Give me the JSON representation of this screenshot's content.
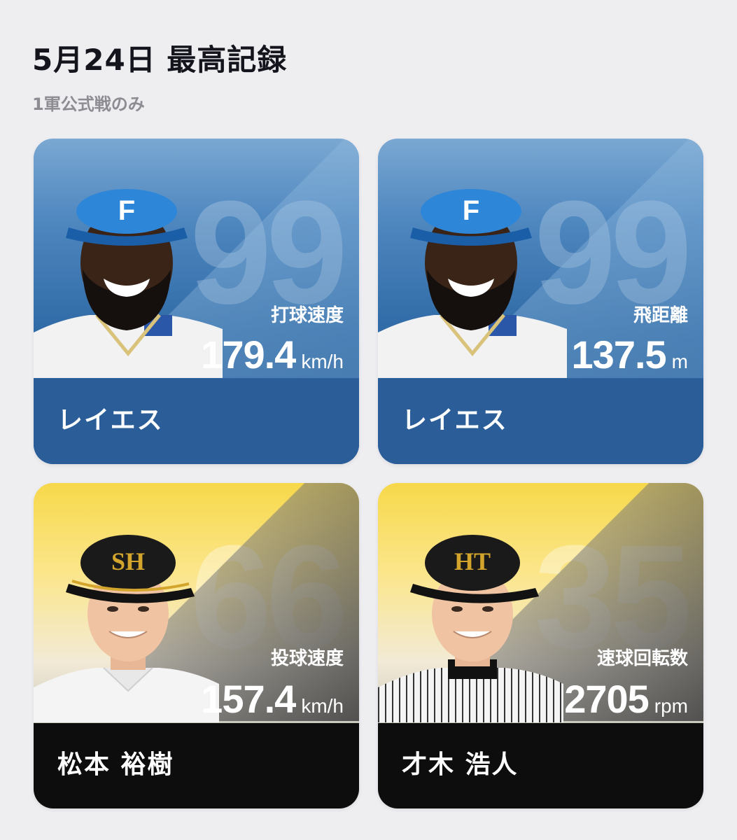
{
  "header": {
    "title": "5月24日 最高記録",
    "subtitle": "1軍公式戦のみ"
  },
  "cards": [
    {
      "theme": "blue",
      "jersey_number": "99",
      "stat_label": "打球速度",
      "stat_value": "179.4",
      "stat_unit": "km/h",
      "player_name": "レイエス",
      "cap_logo": "F"
    },
    {
      "theme": "blue",
      "jersey_number": "99",
      "stat_label": "飛距離",
      "stat_value": "137.5",
      "stat_unit": "m",
      "player_name": "レイエス",
      "cap_logo": "F"
    },
    {
      "theme": "yellow",
      "jersey_number": "66",
      "stat_label": "投球速度",
      "stat_value": "157.4",
      "stat_unit": "km/h",
      "player_name": "松本 裕樹",
      "cap_logo": "SH"
    },
    {
      "theme": "yellow",
      "jersey_number": "35",
      "stat_label": "速球回転数",
      "stat_value": "2705",
      "stat_unit": "rpm",
      "player_name": "才木 浩人",
      "cap_logo": "HT"
    }
  ],
  "colors": {
    "blue_card": "#2f6aa6",
    "yellow_card": "#f7d84a",
    "name_bar_blue": "#2b5e98",
    "name_bar_dark": "#0d0d0d"
  }
}
